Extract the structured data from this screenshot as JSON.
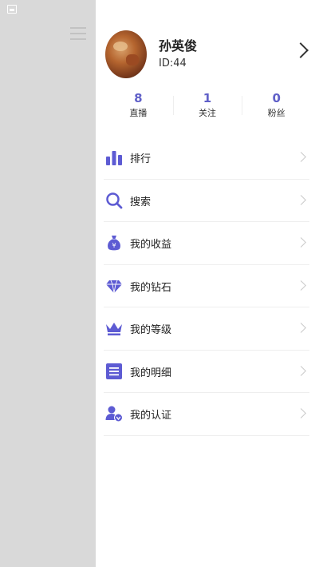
{
  "profile": {
    "name": "孙英俊",
    "id_label": "ID:44"
  },
  "stats": [
    {
      "value": "8",
      "label": "直播"
    },
    {
      "value": "1",
      "label": "关注"
    },
    {
      "value": "0",
      "label": "粉丝"
    }
  ],
  "menu": [
    {
      "label": "排行",
      "icon": "bar-chart-icon"
    },
    {
      "label": "搜索",
      "icon": "search-icon"
    },
    {
      "label": "我的收益",
      "icon": "money-bag-icon"
    },
    {
      "label": "我的钻石",
      "icon": "diamond-icon"
    },
    {
      "label": "我的等级",
      "icon": "crown-icon"
    },
    {
      "label": "我的明细",
      "icon": "document-list-icon"
    },
    {
      "label": "我的认证",
      "icon": "verified-user-icon"
    }
  ],
  "colors": {
    "accent": "#6060c8",
    "icon_purple": "#5d5bd3"
  }
}
